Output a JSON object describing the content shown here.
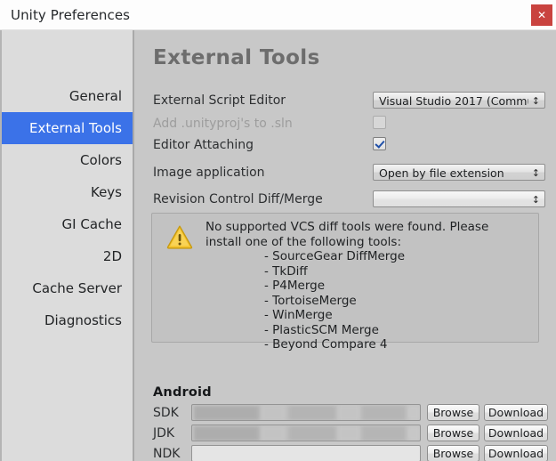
{
  "window": {
    "title": "Unity Preferences",
    "close_label": "✕",
    "accent_selected": "#3b72e8",
    "close_color": "#c9433f"
  },
  "sidebar": {
    "items": [
      {
        "label": "General",
        "selected": false
      },
      {
        "label": "External Tools",
        "selected": true
      },
      {
        "label": "Colors",
        "selected": false
      },
      {
        "label": "Keys",
        "selected": false
      },
      {
        "label": "GI Cache",
        "selected": false
      },
      {
        "label": "2D",
        "selected": false
      },
      {
        "label": "Cache Server",
        "selected": false
      },
      {
        "label": "Diagnostics",
        "selected": false
      }
    ]
  },
  "main": {
    "page_title": "External Tools",
    "fields": [
      {
        "label": "External Script Editor",
        "control": "dropdown",
        "value": "Visual Studio 2017 (Commu",
        "arrow": "↕",
        "disabled": false
      },
      {
        "label": "Add .unityproj's to .sln",
        "control": "checkbox",
        "checked": false,
        "disabled": true
      },
      {
        "label": "Editor Attaching",
        "control": "checkbox",
        "checked": true,
        "disabled": false
      },
      {
        "label": "Image application",
        "control": "dropdown",
        "value": "Open by file extension",
        "arrow": "↕",
        "disabled": false
      },
      {
        "label": "Revision Control Diff/Merge",
        "control": "dropdown",
        "value": "",
        "arrow": "↕",
        "disabled": false
      }
    ],
    "warning": {
      "icon": "warning-triangle-icon",
      "line1": "No supported VCS diff tools were found. Please",
      "line2": "install one of the following tools:",
      "tools": [
        "- SourceGear DiffMerge",
        "- TkDiff",
        "- P4Merge",
        "- TortoiseMerge",
        "- WinMerge",
        "- PlasticSCM Merge",
        "- Beyond Compare 4"
      ]
    },
    "android": {
      "title": "Android",
      "browse_label": "Browse",
      "download_label": "Download",
      "rows": [
        {
          "label": "SDK",
          "value": "",
          "redacted": true
        },
        {
          "label": "JDK",
          "value": "",
          "redacted": true
        },
        {
          "label": "NDK",
          "value": "",
          "redacted": false
        }
      ]
    }
  }
}
